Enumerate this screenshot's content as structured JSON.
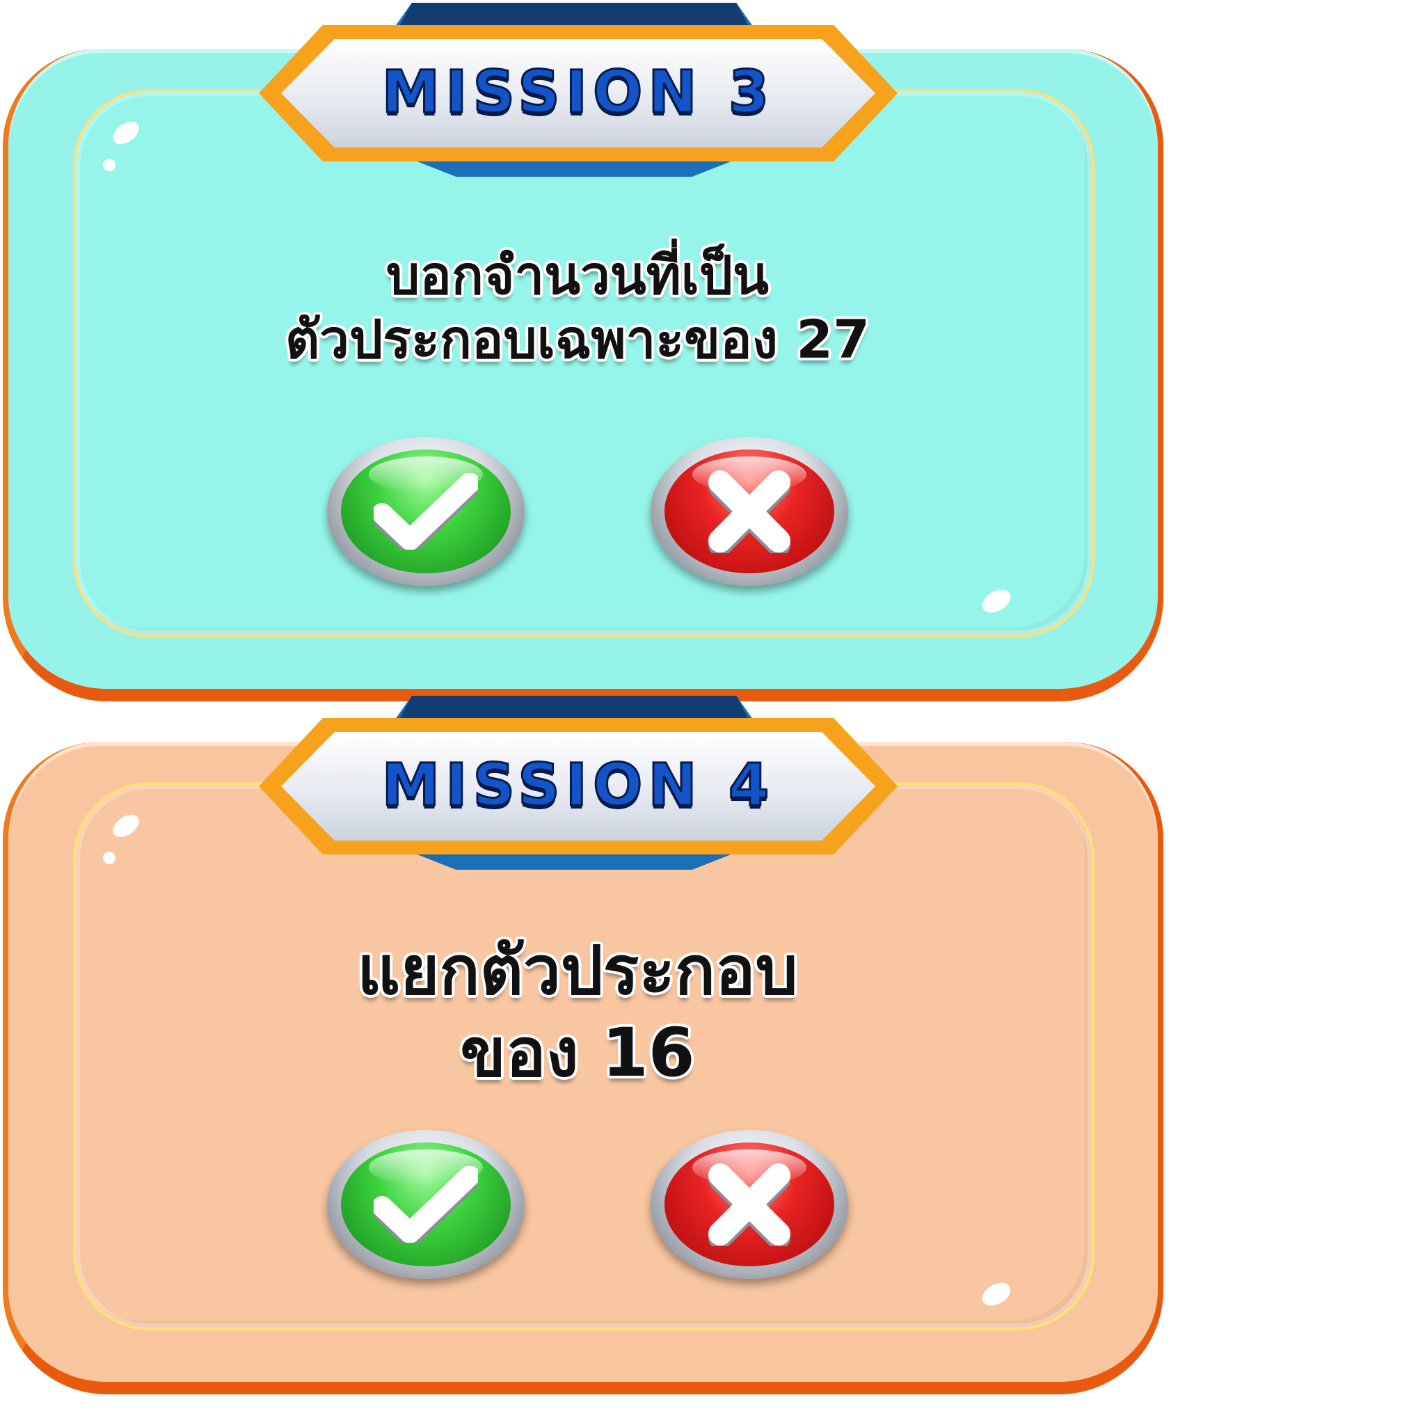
{
  "cards": [
    {
      "title": "MISSION 3",
      "question_lines": [
        "บอกจำนวนที่เป็น",
        "ตัวประกอบเฉพาะของ 27"
      ],
      "panel_color": "#95f3ea",
      "buttons": {
        "yes_icon": "check-icon",
        "no_icon": "cross-icon"
      }
    },
    {
      "title": "MISSION 4",
      "question_lines": [
        "แยกตัวประกอบ",
        "ของ 16"
      ],
      "panel_color": "#f8c59f",
      "buttons": {
        "yes_icon": "check-icon",
        "no_icon": "cross-icon"
      }
    }
  ],
  "colors": {
    "title_text": "#1355c8",
    "banner_orange": "#f7a21c",
    "ribbon_blue": "#1b6fb8",
    "panel_edge": "#e85a0e",
    "yes_green": "#3cd33e",
    "no_red": "#ea2323"
  }
}
